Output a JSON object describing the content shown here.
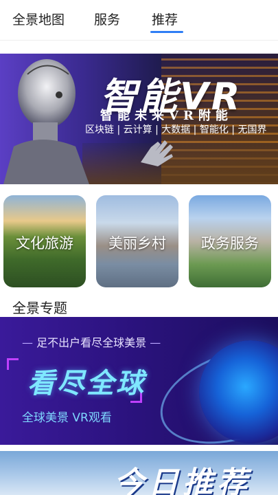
{
  "tabs": [
    {
      "label": "全景地图",
      "active": false
    },
    {
      "label": "服务",
      "active": false
    },
    {
      "label": "推荐",
      "active": true
    }
  ],
  "accent_color": "#2f7ef5",
  "banner_vr": {
    "title": "智能VR",
    "subtitle": "智能未来VR附能",
    "tags": "区块链 | 云计算 | 大数据 | 智能化 | 无国界"
  },
  "category_cards": [
    {
      "label": "文化旅游"
    },
    {
      "label": "美丽乡村"
    },
    {
      "label": "政务服务"
    }
  ],
  "section_title": "全景专题",
  "banner_global": {
    "slogan": "足不出户看尽全球美景",
    "headline": "看尽全球",
    "caption": "全球美景  VR观看"
  },
  "banner_today": {
    "title": "今日推荐"
  }
}
